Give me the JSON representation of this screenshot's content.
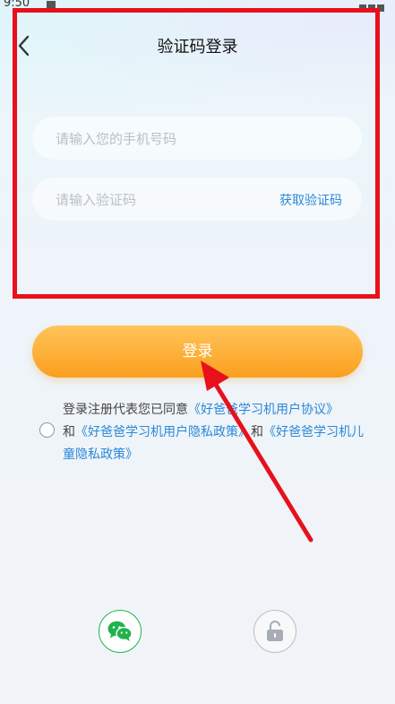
{
  "status_bar": {
    "time": "9:50"
  },
  "header": {
    "title": "验证码登录",
    "back_icon": "chevron-left-icon"
  },
  "form": {
    "phone_placeholder": "请输入您的手机号码",
    "phone_value": "",
    "code_placeholder": "请输入验证码",
    "code_value": "",
    "get_code_label": "获取验证码"
  },
  "login_button": {
    "label": "登录"
  },
  "agreement": {
    "checked": false,
    "prefix": "登录注册代表您已同意",
    "link1": "《好爸爸学习机用户协议》",
    "and1": "和",
    "link2": "《好爸爸学习机用户隐私政策》",
    "and2": "和",
    "link3": "《好爸爸学习机儿童隐私政策》"
  },
  "alt_login": {
    "wechat_icon": "wechat-icon",
    "lock_icon": "unlock-icon"
  },
  "colors": {
    "accent_orange": "#fb9f1e",
    "link_blue": "#2a88d8",
    "wechat_green": "#20b24b",
    "annotation_red": "#e8101c"
  }
}
